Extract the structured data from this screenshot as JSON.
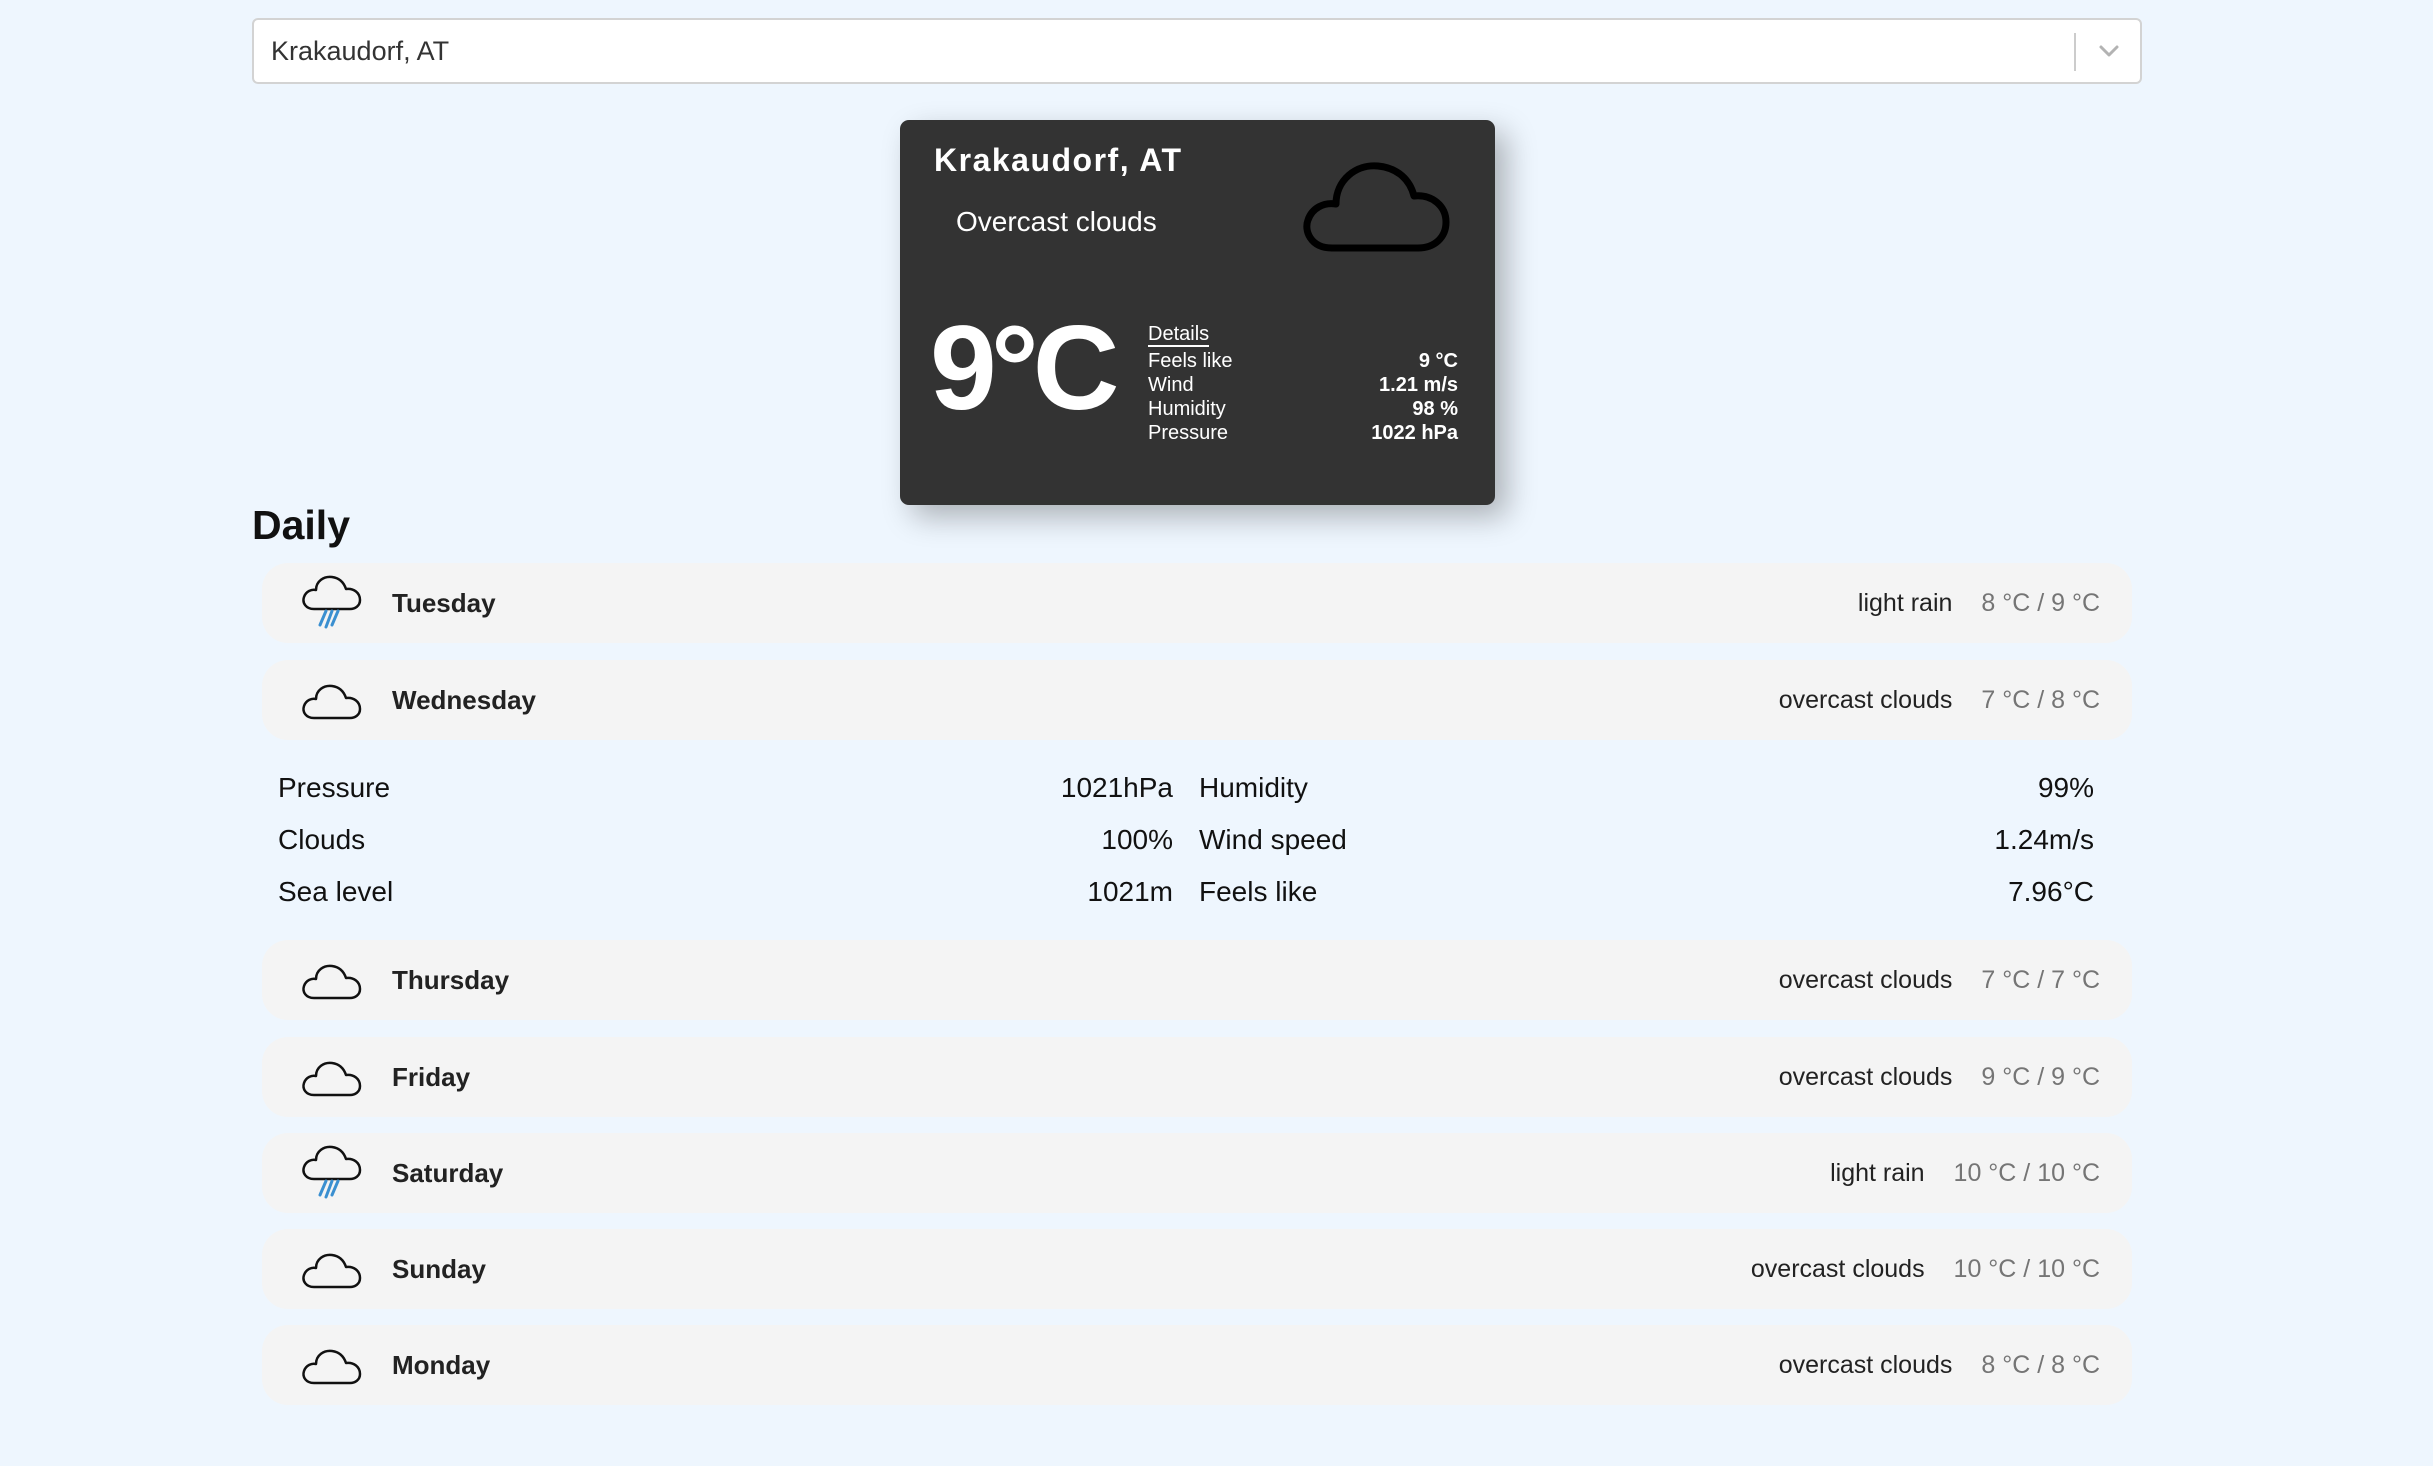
{
  "search": {
    "selected": "Krakaudorf, AT"
  },
  "current": {
    "city": "Krakaudorf, AT",
    "description": "Overcast clouds",
    "icon": "cloud-icon",
    "temperature": "9°C",
    "details_title": "Details",
    "details": [
      {
        "label": "Feels like",
        "value": "9 °C"
      },
      {
        "label": "Wind",
        "value": "1.21 m/s"
      },
      {
        "label": "Humidity",
        "value": "98 %"
      },
      {
        "label": "Pressure",
        "value": "1022 hPa"
      }
    ]
  },
  "daily": {
    "title": "Daily",
    "days": [
      {
        "name": "Tuesday",
        "description": "light rain",
        "temps": "8 °C / 9 °C",
        "icon": "rain-cloud-icon"
      },
      {
        "name": "Wednesday",
        "description": "overcast clouds",
        "temps": "7 °C / 8 °C",
        "icon": "cloud-icon"
      },
      {
        "name": "Thursday",
        "description": "overcast clouds",
        "temps": "7 °C / 7 °C",
        "icon": "cloud-icon"
      },
      {
        "name": "Friday",
        "description": "overcast clouds",
        "temps": "9 °C / 9 °C",
        "icon": "cloud-icon"
      },
      {
        "name": "Saturday",
        "description": "light rain",
        "temps": "10 °C / 10 °C",
        "icon": "rain-cloud-icon"
      },
      {
        "name": "Sunday",
        "description": "overcast clouds",
        "temps": "10 °C / 10 °C",
        "icon": "cloud-icon"
      },
      {
        "name": "Monday",
        "description": "overcast clouds",
        "temps": "8 °C / 8 °C",
        "icon": "cloud-icon"
      }
    ],
    "expanded_details": [
      {
        "label": "Pressure",
        "value": "1021hPa"
      },
      {
        "label": "Humidity",
        "value": "99%"
      },
      {
        "label": "Clouds",
        "value": "100%"
      },
      {
        "label": "Wind speed",
        "value": "1.24m/s"
      },
      {
        "label": "Sea level",
        "value": "1021m"
      },
      {
        "label": "Feels like",
        "value": "7.96°C"
      }
    ]
  },
  "colors": {
    "background": "#eef6fe",
    "card": "#333333",
    "row": "#f4f4f4",
    "rain": "#3a8fd0",
    "muted_temp": "#757575"
  }
}
